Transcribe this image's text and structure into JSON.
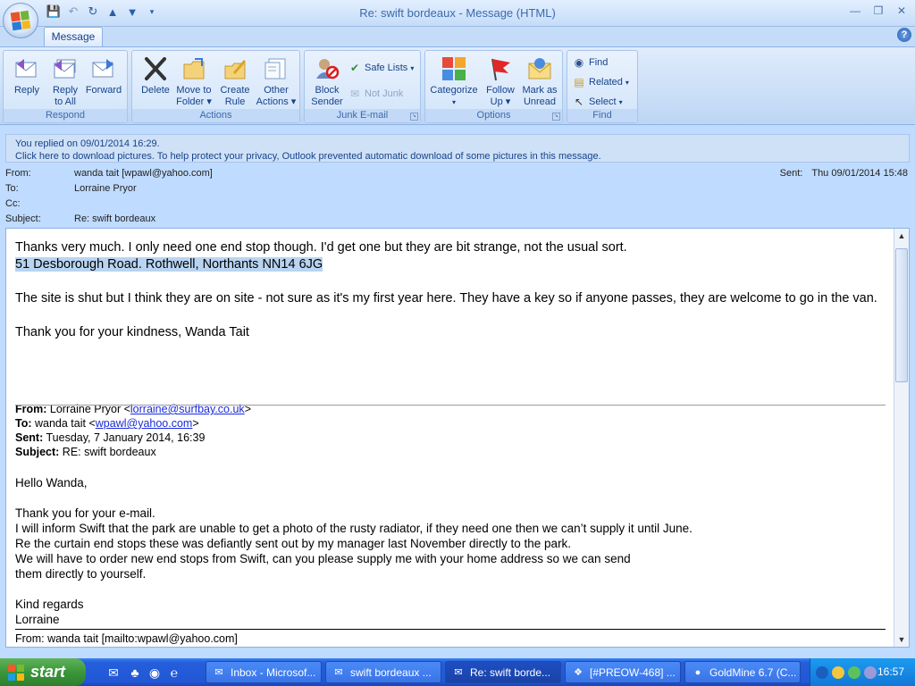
{
  "window": {
    "title": "Re: swift bordeaux  - Message (HTML)",
    "controls": [
      "minimize",
      "restore",
      "close"
    ]
  },
  "quick_access": [
    "save-icon",
    "undo-icon",
    "redo-icon",
    "up-arrow-icon",
    "down-arrow-icon",
    "customize-icon"
  ],
  "ribbon": {
    "tab": "Message",
    "groups": {
      "respond": {
        "label": "Respond",
        "reply": "Reply",
        "reply_all_1": "Reply",
        "reply_all_2": "to All",
        "forward": "Forward"
      },
      "actions": {
        "label": "Actions",
        "delete": "Delete",
        "move_1": "Move to",
        "move_2": "Folder",
        "create_1": "Create",
        "create_2": "Rule",
        "other_1": "Other",
        "other_2": "Actions"
      },
      "junk": {
        "label": "Junk E-mail",
        "block_1": "Block",
        "block_2": "Sender",
        "safe_lists": "Safe Lists",
        "not_junk": "Not Junk"
      },
      "options": {
        "label": "Options",
        "categorize": "Categorize",
        "follow_1": "Follow",
        "follow_2": "Up",
        "mark_1": "Mark as",
        "mark_2": "Unread"
      },
      "find": {
        "label": "Find",
        "find": "Find",
        "related": "Related",
        "select": "Select"
      }
    }
  },
  "infobar": {
    "line1": "You replied on 09/01/2014 16:29.",
    "line2": "Click here to download pictures. To help protect your privacy, Outlook prevented automatic download of some pictures in this message."
  },
  "header": {
    "from_label": "From:",
    "from": "wanda tait [wpawl@yahoo.com]",
    "to_label": "To:",
    "to": "Lorraine Pryor",
    "cc_label": "Cc:",
    "cc": "",
    "subject_label": "Subject:",
    "subject": "Re: swift bordeaux",
    "sent_label": "Sent:",
    "sent": "Thu 09/01/2014 15:48"
  },
  "body": {
    "line1": "Thanks very much. I only need one end stop though. I'd get one but they are bit strange, not the usual sort.",
    "address": "51 Desborough Road. Rothwell, Northants NN14 6JG",
    "para2": "The site is shut but I think they are on site - not sure as it's my first year here. They have a key so if anyone passes, they are welcome to go in the van.",
    "thanks": "Thank you for your kindness, Wanda Tait",
    "quote": {
      "from_label": "From:",
      "from_name": "Lorraine Pryor <",
      "from_email": "lorraine@surfbay.co.uk",
      "from_end": ">",
      "to_label": "To:",
      "to_name": "wanda tait <",
      "to_email": "wpawl@yahoo.com",
      "to_end": ">",
      "sent_label": "Sent:",
      "sent": "Tuesday, 7 January 2014, 16:39",
      "subject_label": "Subject:",
      "subject": "RE: swift bordeaux",
      "greeting": "Hello Wanda,",
      "lines": [
        "Thank you for your e-mail.",
        "I will inform Swift that the park are unable to get a photo of the rusty radiator, if they need one then we can’t supply it until June.",
        "Re the curtain end stops these was defiantly sent out by my manager last November directly to the park.",
        "We will have to order new end stops from Swift, can you please supply me with your home address so we can send",
        "them directly to yourself."
      ],
      "closing1": "Kind regards",
      "closing2": "Lorraine",
      "next_from": "From: wanda tait [mailto:wpawl@yahoo.com]"
    }
  },
  "taskbar": {
    "start": "start",
    "tasks": [
      {
        "label": "Inbox - Microsof...",
        "icon": "outlook-icon"
      },
      {
        "label": "swift bordeaux ...",
        "icon": "email-icon"
      },
      {
        "label": "Re: swift borde...",
        "icon": "email-icon",
        "active": true
      },
      {
        "label": "[#PREOW-468] ...",
        "icon": "bug-icon"
      },
      {
        "label": "GoldMine 6.7 (C...",
        "icon": "goldmine-icon"
      }
    ],
    "clock": "16:57"
  }
}
